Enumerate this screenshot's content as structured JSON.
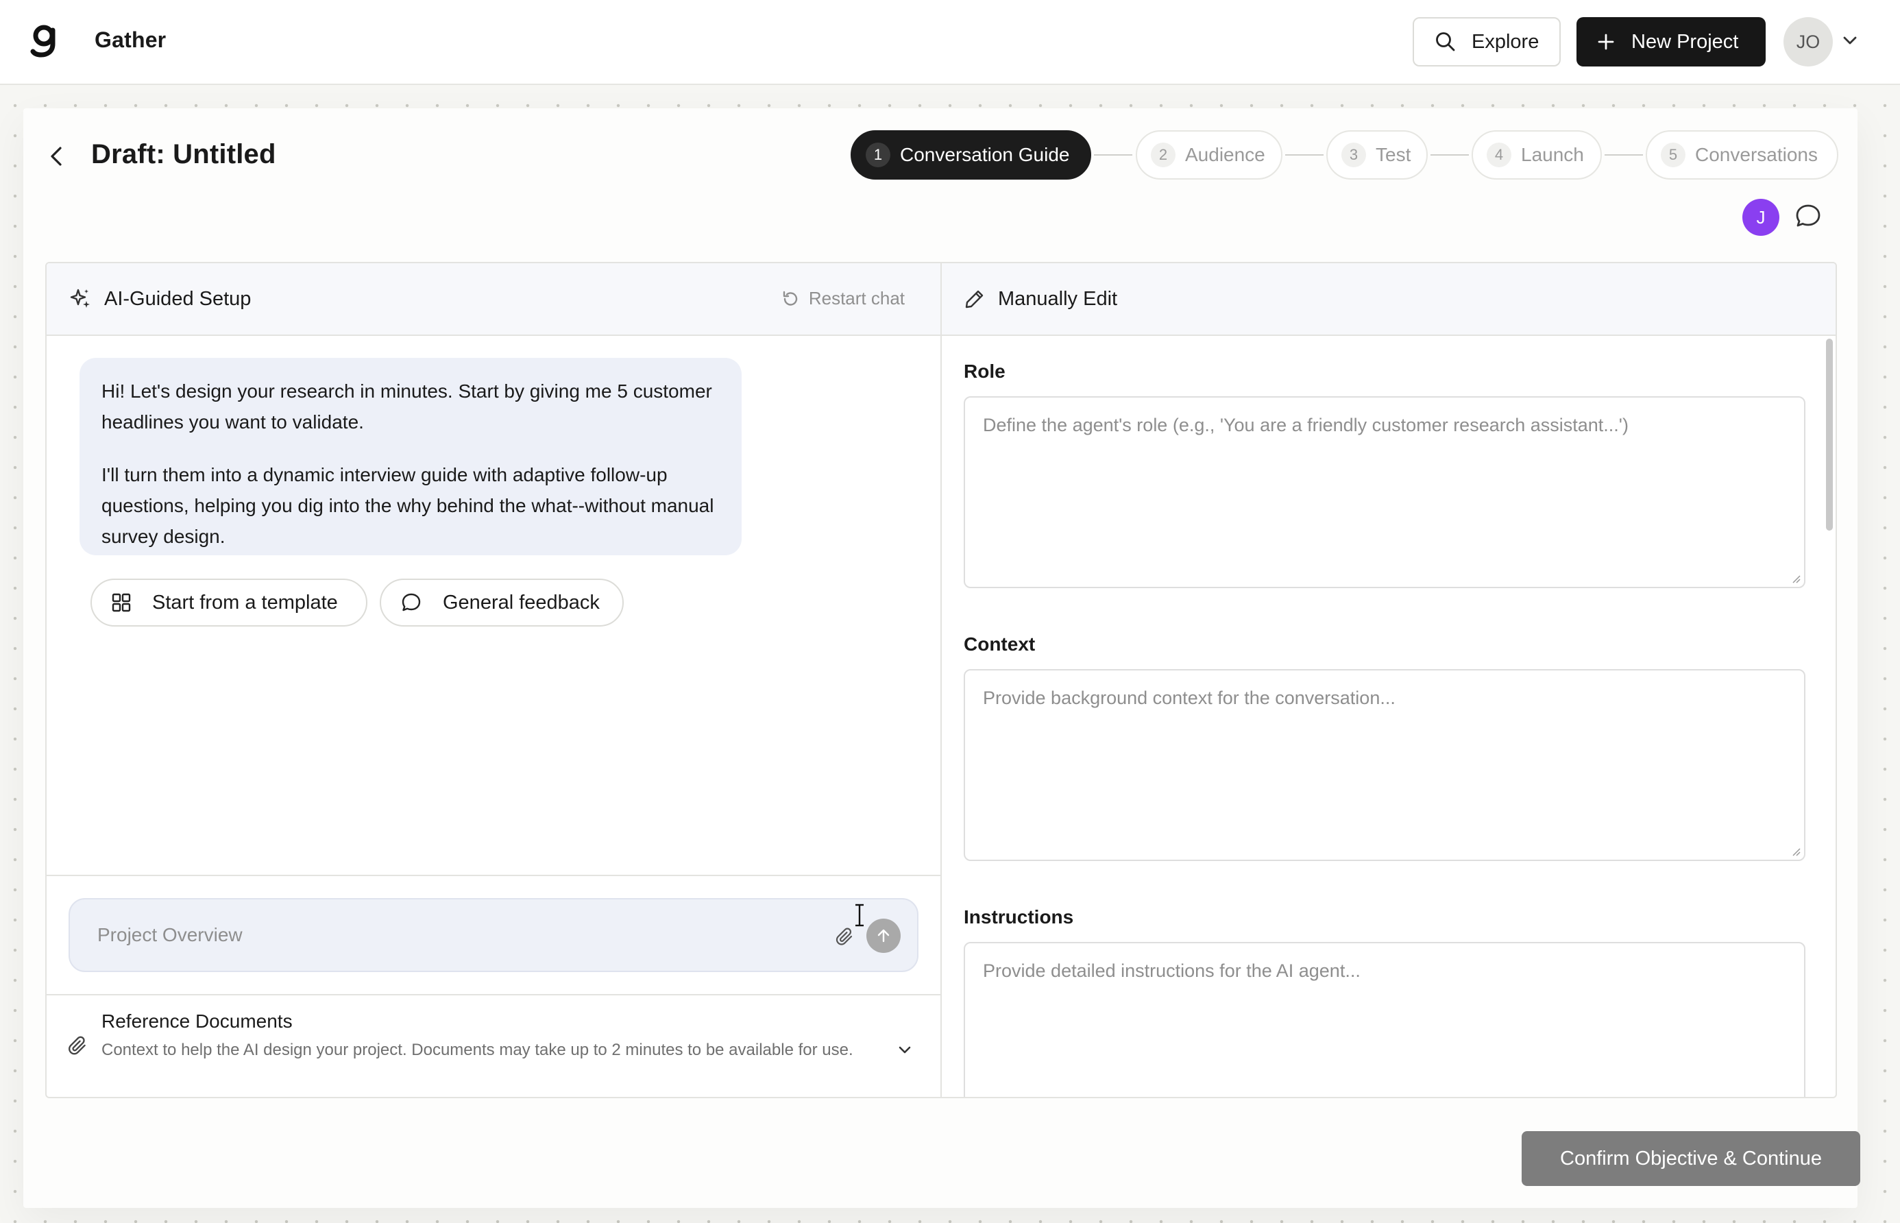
{
  "app": {
    "name": "Gather"
  },
  "header": {
    "explore_label": "Explore",
    "new_project_label": "New Project",
    "user_initials": "JO"
  },
  "page": {
    "title": "Draft: Untitled"
  },
  "steps": [
    {
      "num": "1",
      "label": "Conversation Guide",
      "active": true
    },
    {
      "num": "2",
      "label": "Audience",
      "active": false
    },
    {
      "num": "3",
      "label": "Test",
      "active": false
    },
    {
      "num": "4",
      "label": "Launch",
      "active": false
    },
    {
      "num": "5",
      "label": "Conversations",
      "active": false
    }
  ],
  "collaborator": {
    "initial": "J",
    "color": "#8a3ff0"
  },
  "ai_panel": {
    "title": "AI-Guided Setup",
    "restart_label": "Restart chat",
    "message_p1": "Hi! Let's design your research in minutes. Start by giving me 5 customer headlines you want to validate.",
    "message_p2": "I'll turn them into a dynamic interview guide with adaptive follow-up questions, helping you dig into the why behind the what--without manual survey design.",
    "chips": [
      {
        "label": "Start from a template",
        "icon": "grid-icon"
      },
      {
        "label": "General feedback",
        "icon": "chat-bubble-icon"
      }
    ],
    "composer_placeholder": "Project Overview",
    "reference": {
      "title": "Reference Documents",
      "description": "Context to help the AI design your project. Documents may take up to 2 minutes to be available for use."
    }
  },
  "manual_panel": {
    "title": "Manually Edit",
    "fields": {
      "role": {
        "label": "Role",
        "placeholder": "Define the agent's role (e.g., 'You are a friendly customer research assistant...')"
      },
      "context": {
        "label": "Context",
        "placeholder": "Provide background context for the conversation..."
      },
      "instructions": {
        "label": "Instructions",
        "placeholder": "Provide detailed instructions for the AI agent..."
      }
    }
  },
  "footer": {
    "confirm_label": "Confirm Objective & Continue"
  },
  "colors": {
    "brand_dark": "#171717",
    "accent_purple": "#8a3ff0",
    "bubble_bg": "#edf0f8",
    "disabled_button": "#7d7d7d"
  }
}
